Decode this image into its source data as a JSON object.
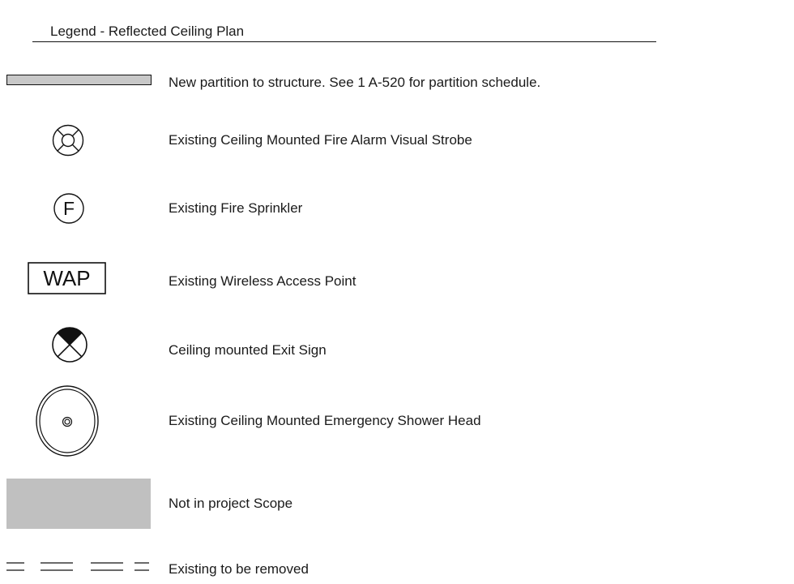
{
  "legend": {
    "title": "Legend - Reflected Ceiling Plan",
    "items": [
      {
        "symbol": "new-partition-bar",
        "description": "New partition to structure.  See 1 A-520 for partition schedule."
      },
      {
        "symbol": "fire-alarm-strobe-icon",
        "description": "Existing Ceiling Mounted Fire Alarm Visual Strobe"
      },
      {
        "symbol": "fire-sprinkler-icon",
        "label": "F",
        "description": "Existing Fire Sprinkler"
      },
      {
        "symbol": "wireless-access-point-icon",
        "label": "WAP",
        "description": "Existing Wireless Access Point"
      },
      {
        "symbol": "exit-sign-icon",
        "description": "Ceiling mounted Exit Sign"
      },
      {
        "symbol": "emergency-shower-head-icon",
        "description": "Existing Ceiling Mounted Emergency Shower Head"
      },
      {
        "symbol": "not-in-scope-swatch",
        "description": "Not in project Scope"
      },
      {
        "symbol": "dashed-removal-line",
        "description": "Existing to be removed"
      }
    ]
  },
  "colors": {
    "partition_fill": "#c8c8c8",
    "scope_fill": "#c0c0c0",
    "line": "#111111",
    "text": "#1a1a1a"
  }
}
